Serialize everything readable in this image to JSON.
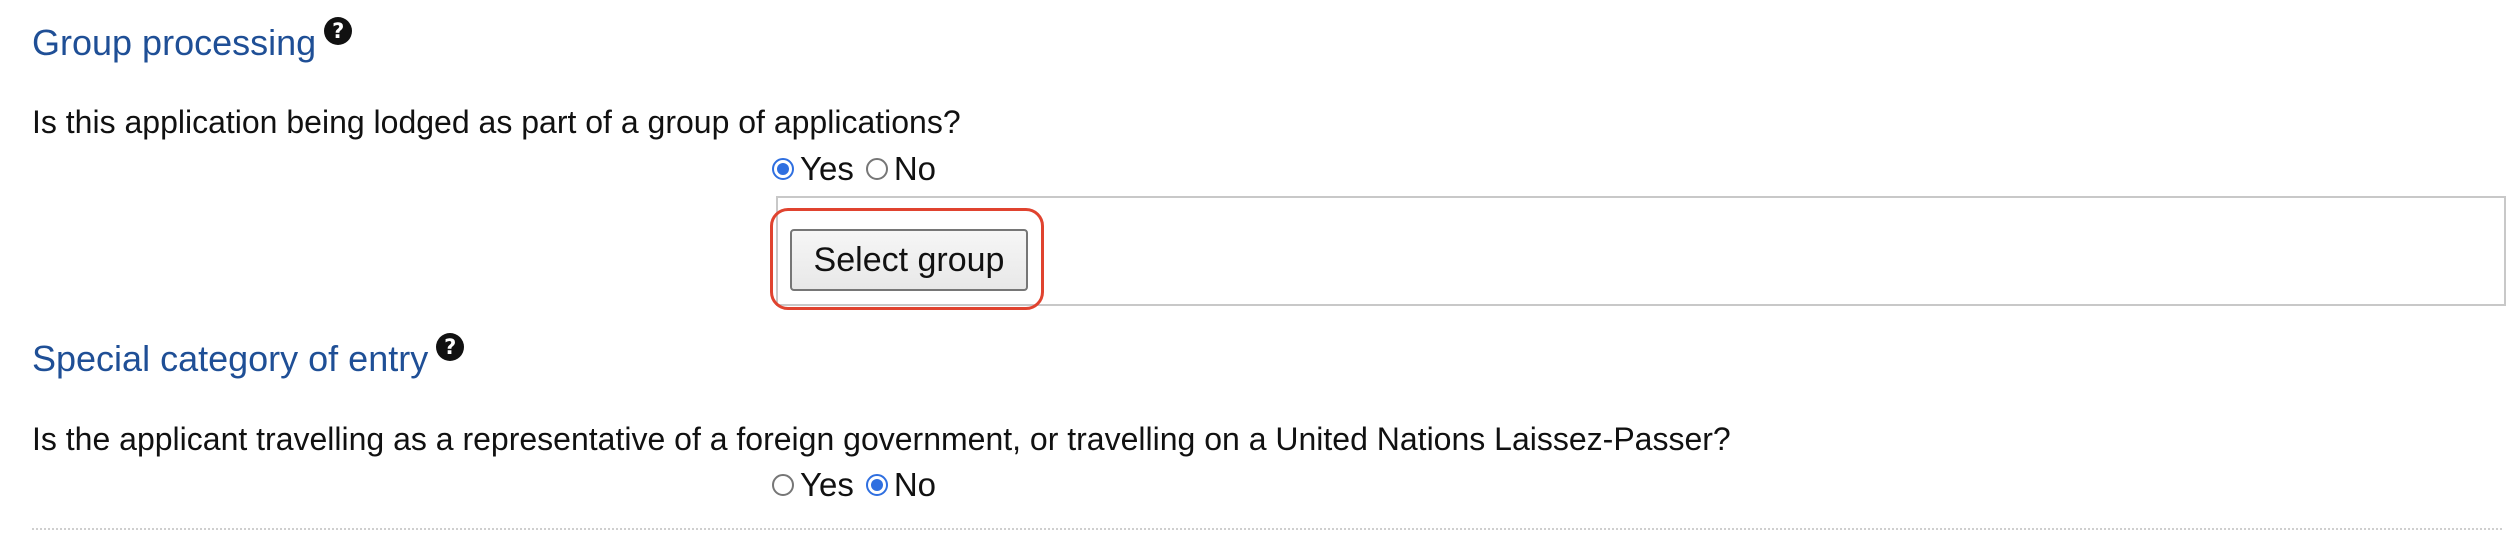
{
  "group_processing": {
    "title": "Group processing",
    "help_icon": "question-circle-icon",
    "question": "Is this application being lodged as part of a group of applications?",
    "options": [
      {
        "label": "Yes",
        "selected": true
      },
      {
        "label": "No",
        "selected": false
      }
    ],
    "select_group_label": "Select group"
  },
  "special_category": {
    "title": "Special category of entry",
    "help_icon": "question-circle-icon",
    "question": "Is the applicant travelling as a representative of a foreign government, or travelling on a United Nations Laissez-Passer?",
    "options": [
      {
        "label": "Yes",
        "selected": false
      },
      {
        "label": "No",
        "selected": true
      }
    ]
  },
  "colors": {
    "section_title": "#1f4f96",
    "radio_selected": "#2f6fe0",
    "highlight": "#e0432f"
  }
}
